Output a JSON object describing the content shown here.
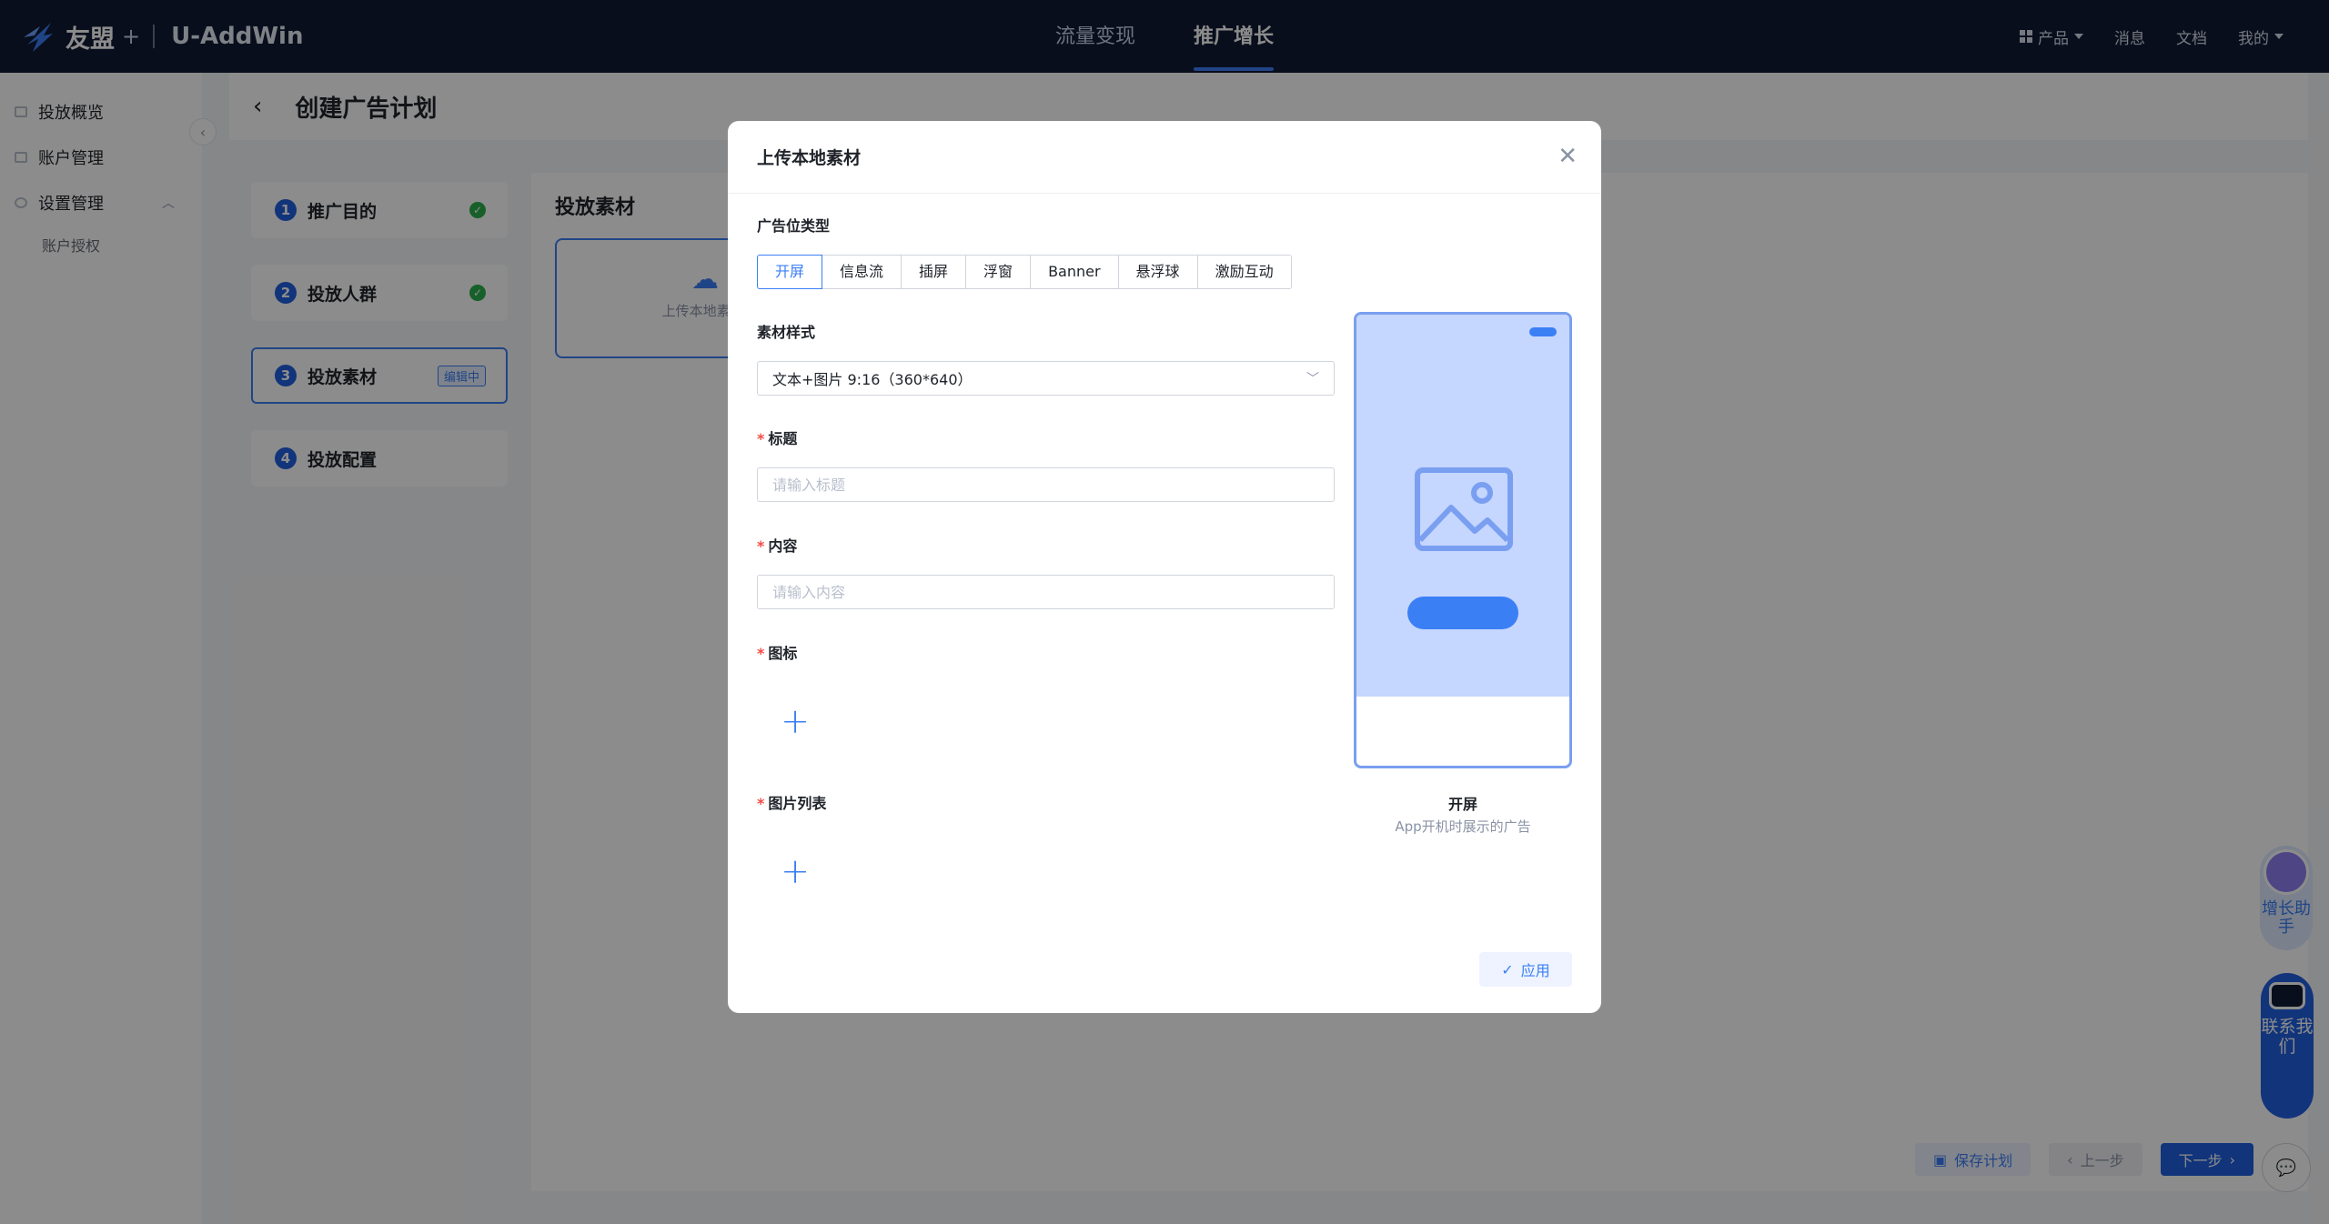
{
  "brand": {
    "name": "友盟",
    "plus": "+",
    "product": "U-AddWin"
  },
  "topnav": {
    "items": [
      "流量变现",
      "推广增长"
    ],
    "active_index": 1
  },
  "topright": {
    "product": "产品",
    "messages": "消息",
    "docs": "文档",
    "mine": "我的"
  },
  "sidebar": {
    "items": [
      {
        "label": "投放概览"
      },
      {
        "label": "账户管理"
      },
      {
        "label": "设置管理",
        "expanded": true
      }
    ],
    "sub_items": [
      "账户授权"
    ]
  },
  "page": {
    "title": "创建广告计划"
  },
  "steps": [
    {
      "num": "1",
      "label": "推广目的",
      "done": true
    },
    {
      "num": "2",
      "label": "投放人群",
      "done": true
    },
    {
      "num": "3",
      "label": "投放素材",
      "badge": "编辑中"
    },
    {
      "num": "4",
      "label": "投放配置"
    }
  ],
  "content": {
    "section_title": "投放素材",
    "upload_text": "上传本地素材,"
  },
  "footer": {
    "save": "保存计划",
    "prev": "上一步",
    "next": "下一步"
  },
  "floats": {
    "helper": "增长助手",
    "contact": "联系我们"
  },
  "modal": {
    "title": "上传本地素材",
    "ad_type_label": "广告位类型",
    "ad_types": [
      "开屏",
      "信息流",
      "插屏",
      "浮窗",
      "Banner",
      "悬浮球",
      "激励互动"
    ],
    "ad_type_selected": "开屏",
    "style_label": "素材样式",
    "style_value": "文本+图片 9:16（360*640）",
    "title_label": "标题",
    "title_placeholder": "请输入标题",
    "content_label": "内容",
    "content_placeholder": "请输入内容",
    "icon_label": "图标",
    "images_label": "图片列表",
    "preview_title": "开屏",
    "preview_desc": "App开机时展示的广告",
    "apply": "应用"
  },
  "colors": {
    "accent": "#3b7ff5",
    "nav_bg": "#0f1a33",
    "success": "#2bb04c",
    "required": "#f54a45"
  }
}
